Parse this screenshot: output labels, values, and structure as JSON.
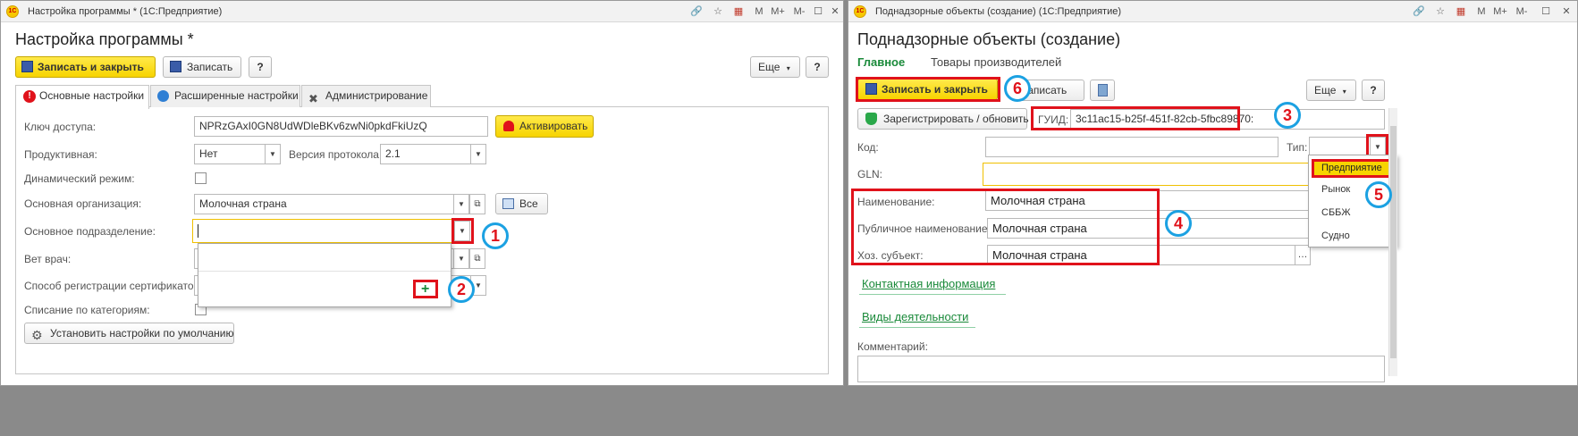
{
  "left_window": {
    "title": "Настройка программы * (1С:Предприятие)",
    "titlebar_icons": [
      "link-icon",
      "bookmark-icon",
      "calendar-icon",
      "M",
      "M+",
      "M-",
      "maximize-icon",
      "close-icon"
    ],
    "heading": "Настройка программы *",
    "toolbar": {
      "save_close": "Записать и закрыть",
      "save": "Записать",
      "help": "?",
      "more": "Еще",
      "help2": "?"
    },
    "tabs": [
      "Основные настройки",
      "Расширенные настройки",
      "Администрирование"
    ],
    "fields": {
      "access_key_label": "Ключ доступа:",
      "access_key_value": "NPRzGAxI0GN8UdWDleBKv6zwNi0pkdFkiUzQ",
      "activate_button": "Активировать",
      "productive_label": "Продуктивная:",
      "productive_value": "Нет",
      "protocol_label": "Версия протокола:",
      "protocol_value": "2.1",
      "dynamic_label": "Динамический режим:",
      "org_label": "Основная организация:",
      "org_value": "Молочная страна",
      "all_button": "Все",
      "division_label": "Основное подразделение:",
      "vet_label": "Вет врач:",
      "cert_label": "Способ регистрации сертификатов:",
      "category_label": "Списание по категориям:",
      "defaults_button": "Установить настройки по умолчанию"
    },
    "callouts": [
      "1",
      "2"
    ]
  },
  "right_window": {
    "title": "Поднадзорные объекты (создание) (1С:Предприятие)",
    "heading": "Поднадзорные объекты (создание)",
    "nav": {
      "main": "Главное",
      "products": "Товары производителей"
    },
    "toolbar": {
      "save_close": "Записать и закрыть",
      "save": "Записать",
      "more": "Еще",
      "help": "?"
    },
    "register_button": "Зарегистрировать / обновить",
    "guid_label": "ГУИД:",
    "guid_value": "3c11ac15-b25f-451f-82cb-5fbc89870:",
    "code_label": "Код:",
    "type_label": "Тип:",
    "gln_label": "GLN:",
    "name_label": "Наименование:",
    "name_value": "Молочная страна",
    "public_name_label": "Публичное наименование:",
    "public_name_value": "Молочная страна",
    "entity_label": "Хоз. субъект:",
    "entity_value": "Молочная страна",
    "contact_link": "Контактная информация",
    "activity_link": "Виды деятельности",
    "comment_label": "Комментарий:",
    "type_options": [
      "Предприятие",
      "Рынок",
      "СББЖ",
      "Судно"
    ],
    "callouts": [
      "3",
      "4",
      "5",
      "6"
    ]
  },
  "colors": {
    "accent_yellow": "#f7d400",
    "highlight_red": "#e0121b",
    "callout_blue": "#1ba1e2",
    "link_green": "#1a8a3a"
  }
}
